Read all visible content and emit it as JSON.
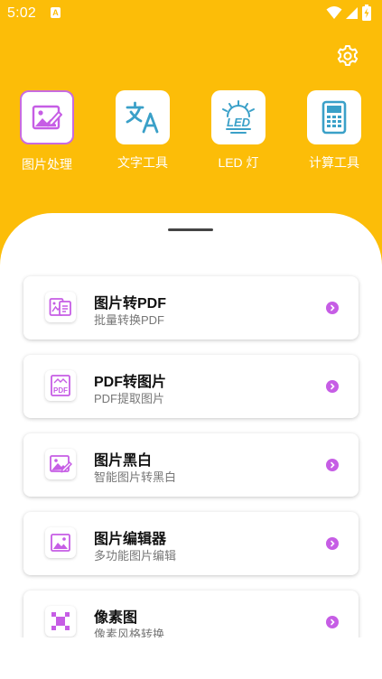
{
  "status_bar": {
    "time": "5:02",
    "indicator_letter": "A"
  },
  "header": {
    "settings_icon": "gear-icon"
  },
  "tools": [
    {
      "label": "图片处理",
      "icon": "image-edit-icon",
      "active": true
    },
    {
      "label": "文字工具",
      "icon": "translate-icon",
      "active": false
    },
    {
      "label": "LED 灯",
      "icon": "led-icon",
      "active": false
    },
    {
      "label": "计算工具",
      "icon": "calculator-icon",
      "active": false
    }
  ],
  "cards": [
    {
      "title": "图片转PDF",
      "subtitle": "批量转换PDF",
      "icon": "image-to-pdf-icon"
    },
    {
      "title": "PDF转图片",
      "subtitle": "PDF提取图片",
      "icon": "pdf-to-image-icon"
    },
    {
      "title": "图片黑白",
      "subtitle": "智能图片转黑白",
      "icon": "image-bw-icon"
    },
    {
      "title": "图片编辑器",
      "subtitle": "多功能图片编辑",
      "icon": "image-editor-icon"
    },
    {
      "title": "像素图",
      "subtitle": "像素风格转换",
      "icon": "pixel-icon"
    }
  ],
  "colors": {
    "header_bg": "#FCBD08",
    "accent": "#C65DE5",
    "icon_blue": "#3AA0C8",
    "card_bg": "#FFFFFF"
  }
}
